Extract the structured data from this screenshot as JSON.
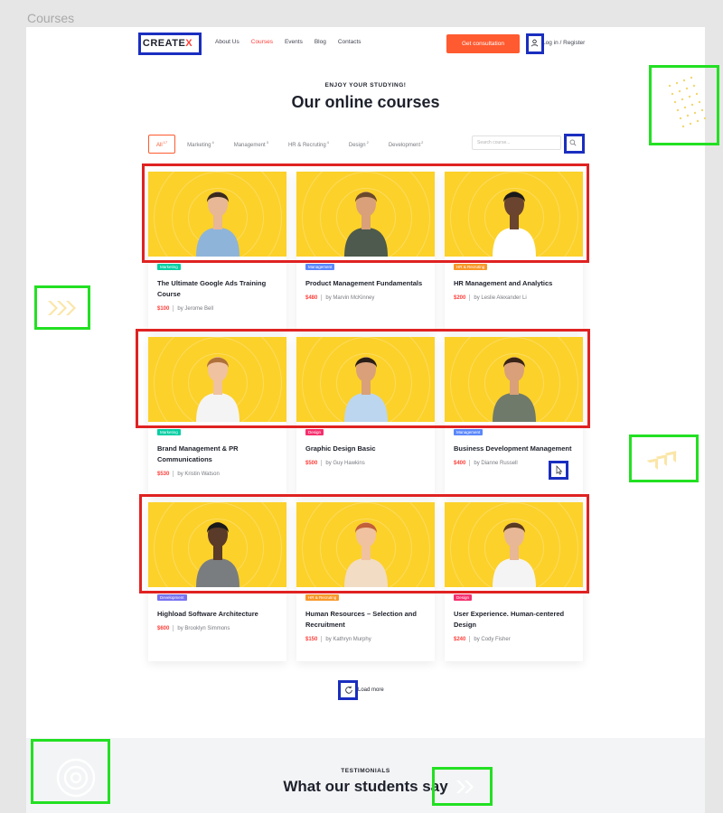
{
  "frame_title": "Courses",
  "header": {
    "logo_main": "CREATE",
    "logo_x": "X",
    "nav": [
      "About Us",
      "Courses",
      "Events",
      "Blog",
      "Contacts"
    ],
    "active_nav": "Courses",
    "cta": "Get consultation",
    "login": "Log in / Register"
  },
  "hero": {
    "subtitle": "ENJOY YOUR STUDYING!",
    "title": "Our online courses"
  },
  "filters": {
    "items": [
      {
        "label": "All",
        "count": "17"
      },
      {
        "label": "Marketing",
        "count": "4"
      },
      {
        "label": "Management",
        "count": "3"
      },
      {
        "label": "HR & Recruting",
        "count": "4"
      },
      {
        "label": "Design",
        "count": "2"
      },
      {
        "label": "Development",
        "count": "2"
      }
    ],
    "search_placeholder": "Search course..."
  },
  "tag_colors": {
    "Marketing": "#03cea4",
    "Management": "#5a87fc",
    "HR & Recruting": "#f89828",
    "Design": "#f52f6e",
    "Development": "#7772f1"
  },
  "courses": [
    {
      "tag": "Marketing",
      "title": "The Ultimate Google Ads Training Course",
      "price": "$100",
      "author": "by Jerome Bell",
      "shirt": "#8fb4d9",
      "hair": "#3a2a1e",
      "skin": "#e8b796"
    },
    {
      "tag": "Management",
      "title": "Product Management Fundamentals",
      "price": "$480",
      "author": "by Marvin McKinney",
      "shirt": "#4d5a4d",
      "hair": "#6b4a2c",
      "skin": "#d9a07a"
    },
    {
      "tag": "HR & Recruting",
      "title": "HR  Management and Analytics",
      "price": "$200",
      "author": "by Leslie Alexander Li",
      "shirt": "#ffffff",
      "hair": "#1a1a1a",
      "skin": "#6b4430"
    },
    {
      "tag": "Marketing",
      "title": "Brand Management & PR Communications",
      "price": "$530",
      "author": "by Kristin Watson",
      "shirt": "#f4f4f4",
      "hair": "#b0703a",
      "skin": "#f0c2a0"
    },
    {
      "tag": "Design",
      "title": "Graphic Design Basic",
      "price": "$500",
      "author": "by Guy Hawkins",
      "shirt": "#bcd6ef",
      "hair": "#2a1e18",
      "skin": "#d9a07a"
    },
    {
      "tag": "Management",
      "title": "Business Development Management",
      "price": "$400",
      "author": "by Dianne Russell",
      "shirt": "#6f7a6a",
      "hair": "#3a2418",
      "skin": "#d9a07a"
    },
    {
      "tag": "Development",
      "title": "Highload Software Architecture",
      "price": "$600",
      "author": "by Brooklyn Simmons",
      "shirt": "#7a7d80",
      "hair": "#1a1a1a",
      "skin": "#5a3a28"
    },
    {
      "tag": "HR & Recruting",
      "title": "Human Resources – Selection and Recruitment",
      "price": "$150",
      "author": "by Kathryn Murphy",
      "shirt": "#f2dcc3",
      "hair": "#c2603a",
      "skin": "#f0c2a0"
    },
    {
      "tag": "Design",
      "title": "User Experience. Human-centered Design",
      "price": "$240",
      "author": "by Cody Fisher",
      "shirt": "#f4f4f4",
      "hair": "#5a3a20",
      "skin": "#e8b796"
    }
  ],
  "load_more": "Load more",
  "testimonials": {
    "subtitle": "TESTIMONIALS",
    "title": "What our students say"
  }
}
